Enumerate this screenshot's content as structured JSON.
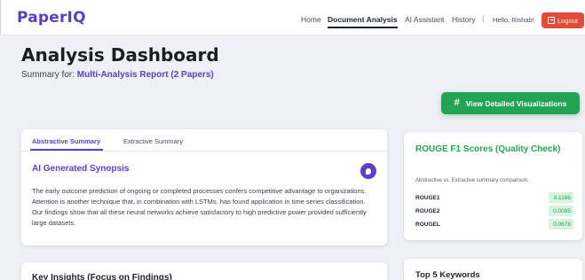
{
  "nav": {
    "logo": "PaperIQ",
    "links": [
      "Home",
      "Document Analysis",
      "AI Assistant",
      "History"
    ],
    "separator": "|",
    "greeting": "Hello, Rishab!",
    "logout": "Logout"
  },
  "header": {
    "title": "Analysis Dashboard",
    "subtitle_prefix": "Summary for:",
    "report_name": "Multi-Analysis Report (2 Papers)"
  },
  "actions": {
    "viz_button": "View Detailed Visualizations"
  },
  "summary": {
    "tabs": [
      "Abstractive Summary",
      "Extractive Summary"
    ],
    "active_tab": "Abstractive Summary",
    "synopsis_title": "AI Generated Synopsis",
    "synopsis_text": "The early outcome prediction of ongoing or completed processes confers competitive advantage to organizations. Attention is another technique that, in combination with LSTMs, has found application in time series classification. Our findings show that all these neural networks achieve satisfactory to high predictive power provided sufficiently large datasets."
  },
  "insights": {
    "title": "Key Insights (Focus on Findings)"
  },
  "rouge": {
    "title": "ROUGE F1 Scores (Quality Check)",
    "subtitle": "Abstractive vs. Extractive summary comparison.",
    "rows": [
      {
        "name": "ROUGE1",
        "value": "0.1186"
      },
      {
        "name": "ROUGE2",
        "value": "0.0085"
      },
      {
        "name": "ROUGEL",
        "value": "0.0678"
      }
    ]
  },
  "keywords": {
    "title": "Top 5 Keywords"
  },
  "colors": {
    "brand": "#5b3fc4",
    "success": "#23a455",
    "danger": "#e24c3b"
  },
  "icons": [
    "logout-icon",
    "hash-icon",
    "audio-icon"
  ]
}
